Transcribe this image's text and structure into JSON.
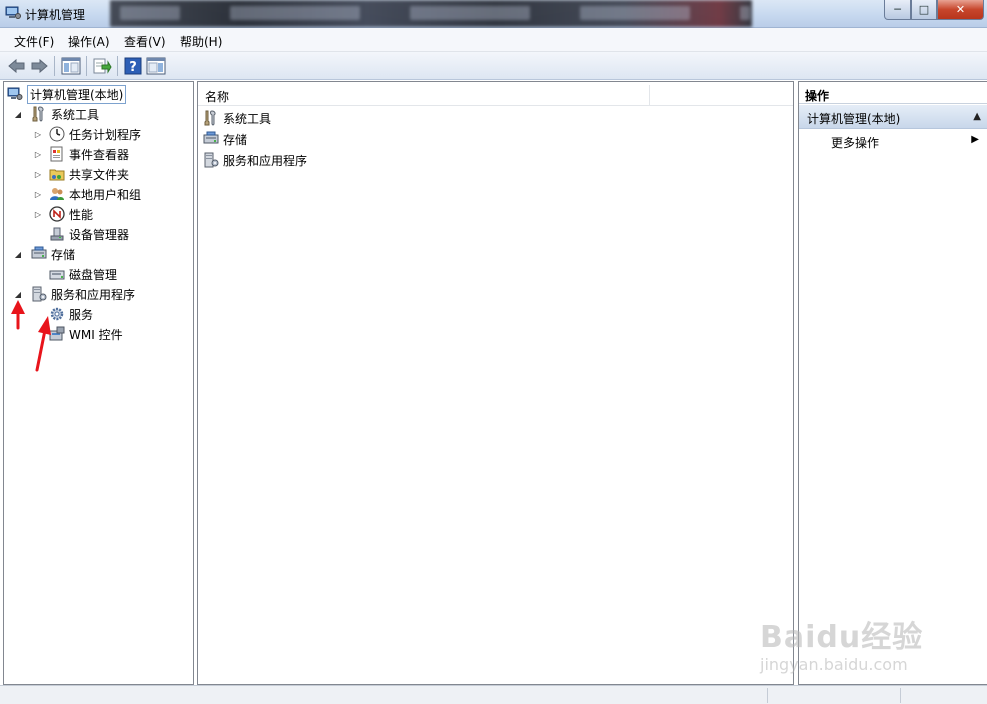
{
  "window": {
    "title": "计算机管理",
    "controls": {
      "minimize": "─",
      "maximize": "□",
      "close": "✕"
    }
  },
  "menu": [
    {
      "label": "文件(F)"
    },
    {
      "label": "操作(A)"
    },
    {
      "label": "查看(V)"
    },
    {
      "label": "帮助(H)"
    }
  ],
  "toolbar": {
    "icons": [
      "back-arrow-icon",
      "forward-arrow-icon",
      "show-hide-tree-icon",
      "export-list-icon",
      "help-icon",
      "show-hide-action-pane-icon"
    ]
  },
  "tree": {
    "root": "计算机管理(本地)",
    "items": [
      {
        "label": "系统工具",
        "expander": "◢"
      },
      {
        "label": "任务计划程序",
        "expander": "▷"
      },
      {
        "label": "事件查看器",
        "expander": "▷"
      },
      {
        "label": "共享文件夹",
        "expander": "▷"
      },
      {
        "label": "本地用户和组",
        "expander": "▷"
      },
      {
        "label": "性能",
        "expander": "▷"
      },
      {
        "label": "设备管理器",
        "expander": ""
      },
      {
        "label": "存储",
        "expander": "◢"
      },
      {
        "label": "磁盘管理",
        "expander": ""
      },
      {
        "label": "服务和应用程序",
        "expander": "◢"
      },
      {
        "label": "服务",
        "expander": ""
      },
      {
        "label": "WMI 控件",
        "expander": ""
      }
    ]
  },
  "list": {
    "column": "名称",
    "rows": [
      {
        "label": "系统工具"
      },
      {
        "label": "存储"
      },
      {
        "label": "服务和应用程序"
      }
    ]
  },
  "actions": {
    "header": "操作",
    "section": "计算机管理(本地)",
    "collapse_glyph": "▲",
    "more": "更多操作",
    "more_glyph": "▶"
  },
  "watermark": {
    "text": "Baidu经验",
    "sub": "jingyan.baidu.com"
  },
  "colors": {
    "accent_arrow": "#e8141b",
    "titlebar": "#c9daf0",
    "selection_border": "#7da2ce"
  }
}
